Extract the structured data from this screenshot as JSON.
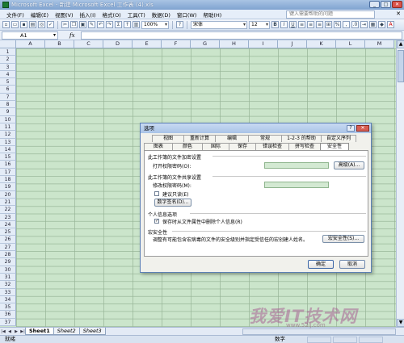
{
  "window": {
    "title": "Microsoft Excel - 新建 Microsoft Excel 工作表 (4).xls",
    "buttons": [
      "_",
      "□",
      "✕"
    ]
  },
  "menu": {
    "items": [
      "文件(F)",
      "编辑(E)",
      "视图(V)",
      "插入(I)",
      "格式(O)",
      "工具(T)",
      "数据(D)",
      "窗口(W)",
      "帮助(H)"
    ],
    "help_placeholder": "键入需要帮助的问题",
    "close": "✕"
  },
  "toolbar": {
    "zoom": "100%",
    "font": "宋体",
    "size": "12"
  },
  "formula_bar": {
    "name_box": "A1",
    "fx": "fx"
  },
  "grid": {
    "columns": [
      "A",
      "B",
      "C",
      "D",
      "E",
      "F",
      "G",
      "H",
      "I",
      "J",
      "K",
      "L",
      "M"
    ],
    "rows": [
      "1",
      "2",
      "3",
      "4",
      "5",
      "6",
      "7",
      "8",
      "9",
      "10",
      "11",
      "12",
      "13",
      "14",
      "15",
      "16",
      "17",
      "18",
      "19",
      "20",
      "21",
      "22",
      "23",
      "24",
      "25",
      "26",
      "27",
      "28",
      "29",
      "30",
      "31",
      "32",
      "33",
      "34",
      "35",
      "36",
      "37"
    ]
  },
  "sheets": {
    "tabs": [
      "Sheet1",
      "Sheet2",
      "Sheet3"
    ],
    "active": "Sheet1"
  },
  "status": {
    "left": "就绪",
    "right": "数字"
  },
  "dialog": {
    "title": "选项",
    "help_btn": "?",
    "close_btn": "✕",
    "tabs_row1": [
      "视图",
      "重新计算",
      "编辑",
      "常规",
      "1-2-3 的帮助",
      "自定义序列"
    ],
    "tabs_row2": [
      "图表",
      "颜色",
      "国际",
      "保存",
      "错误检查",
      "拼写检查",
      "安全性"
    ],
    "active_tab": "安全性",
    "sec_encrypt": "此工作簿的文件加密设置",
    "open_pwd_label": "打开权限密码(O):",
    "advanced_btn": "高级(A)...",
    "sec_share": "此工作簿的文件共享设置",
    "modify_pwd_label": "修改权限密码(M):",
    "readonly_label": "建议只读(E)",
    "signature_btn": "数字签名(D)...",
    "sec_privacy": "个人信息选项",
    "privacy_label": "保存时从文件属性中删除个人信息(R)",
    "sec_macro": "宏安全性",
    "macro_desc": "调整有可能包含宏病毒的文件的安全级别并指定受信任的宏创建人姓名。",
    "macro_btn": "宏安全性(S)...",
    "ok": "确定",
    "cancel": "取消"
  },
  "watermark": {
    "text": "我爱IT技术网",
    "sub": "www.52ij.com"
  }
}
